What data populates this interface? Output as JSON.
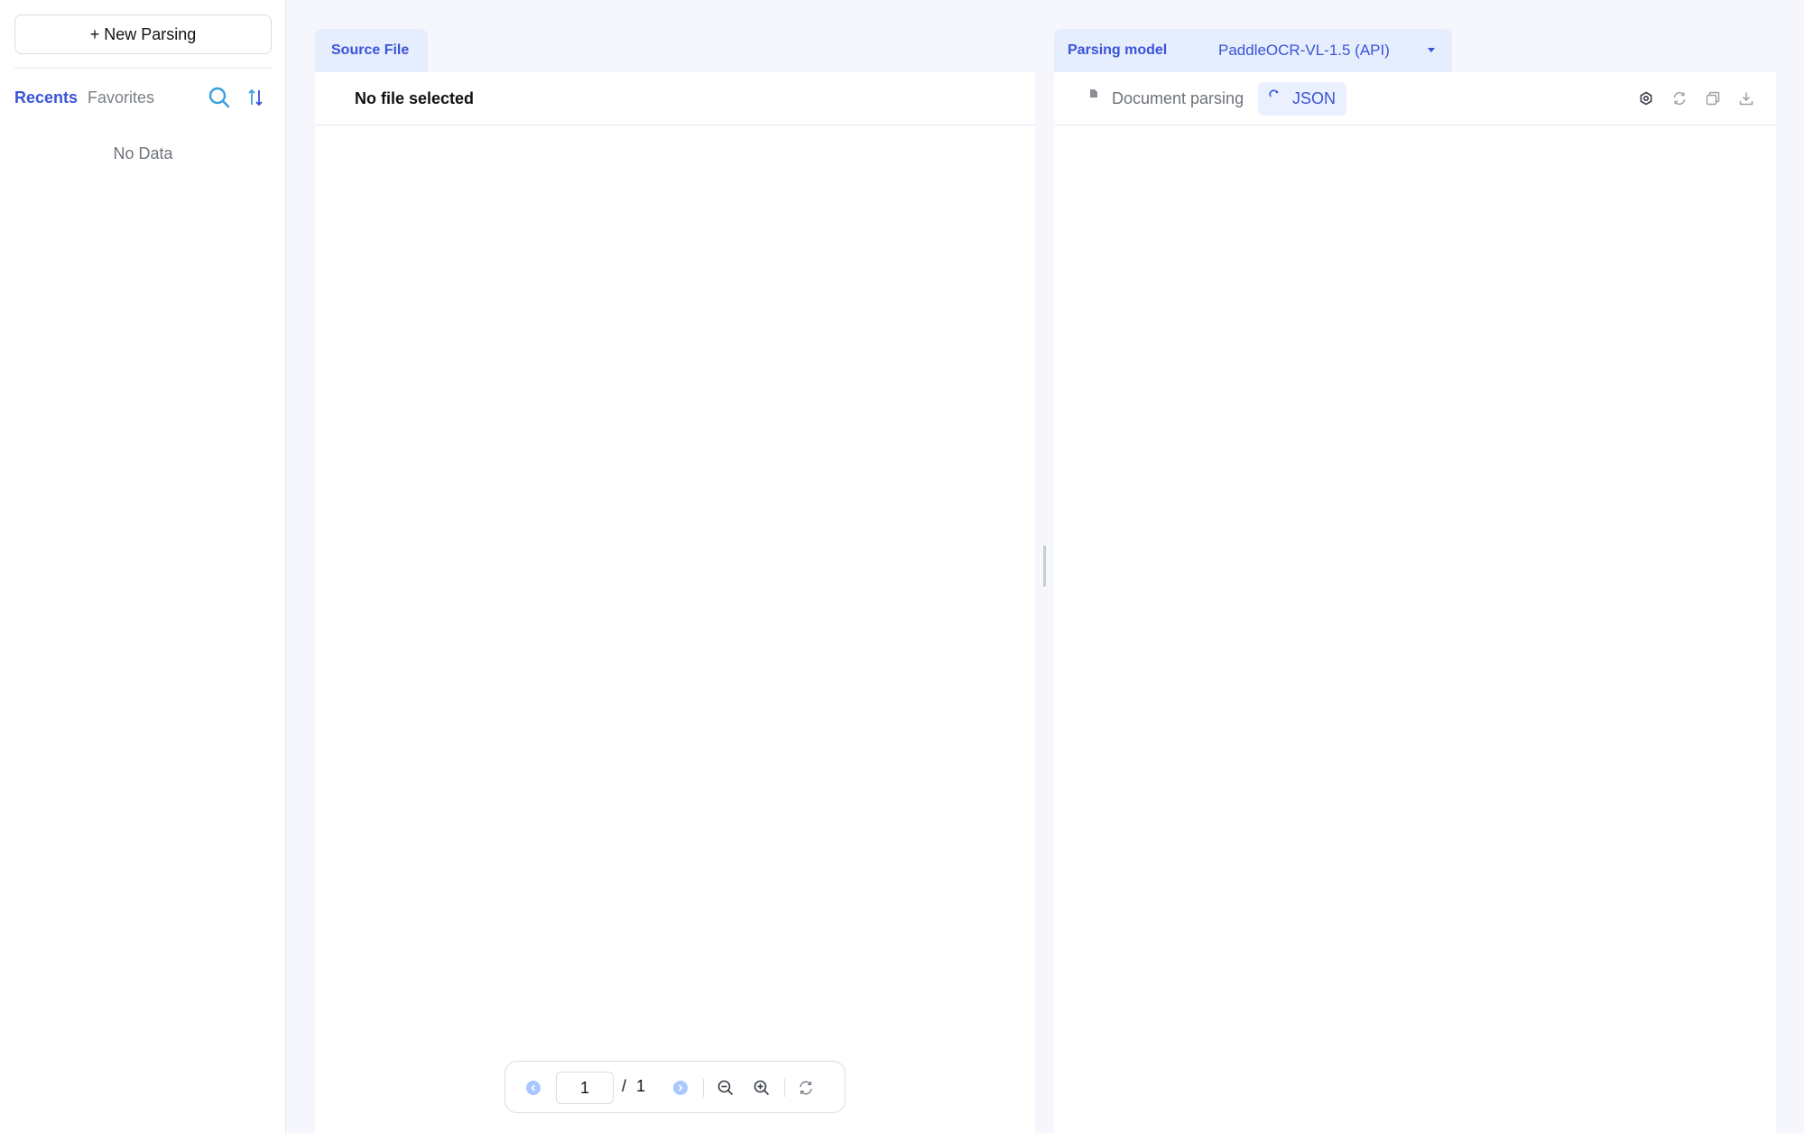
{
  "sidebar": {
    "new_button_label": "+ New Parsing",
    "tabs": [
      {
        "label": "Recents",
        "active": true
      },
      {
        "label": "Favorites",
        "active": false
      }
    ],
    "empty_text": "No Data",
    "icons": {
      "search": "search-icon",
      "sort": "sort-icon"
    }
  },
  "source_panel": {
    "tab_label": "Source File",
    "file_label": "No file selected"
  },
  "result_panel": {
    "model_label": "Parsing model",
    "model_value": "PaddleOCR-VL-1.5 (API)",
    "view_tabs": [
      {
        "label": "Document parsing",
        "active": false,
        "icon": "document-icon"
      },
      {
        "label": "JSON",
        "active": true,
        "icon": "json-icon"
      }
    ],
    "toolbar_icons": [
      "settings-icon",
      "refresh-icon",
      "copy-icon",
      "download-icon"
    ]
  },
  "pager": {
    "current_page": "1",
    "separator": "/",
    "total_pages": "1"
  },
  "colors": {
    "accent": "#3a54d8",
    "chip_background": "#e6edfd",
    "page_background": "#f5f7fc"
  }
}
